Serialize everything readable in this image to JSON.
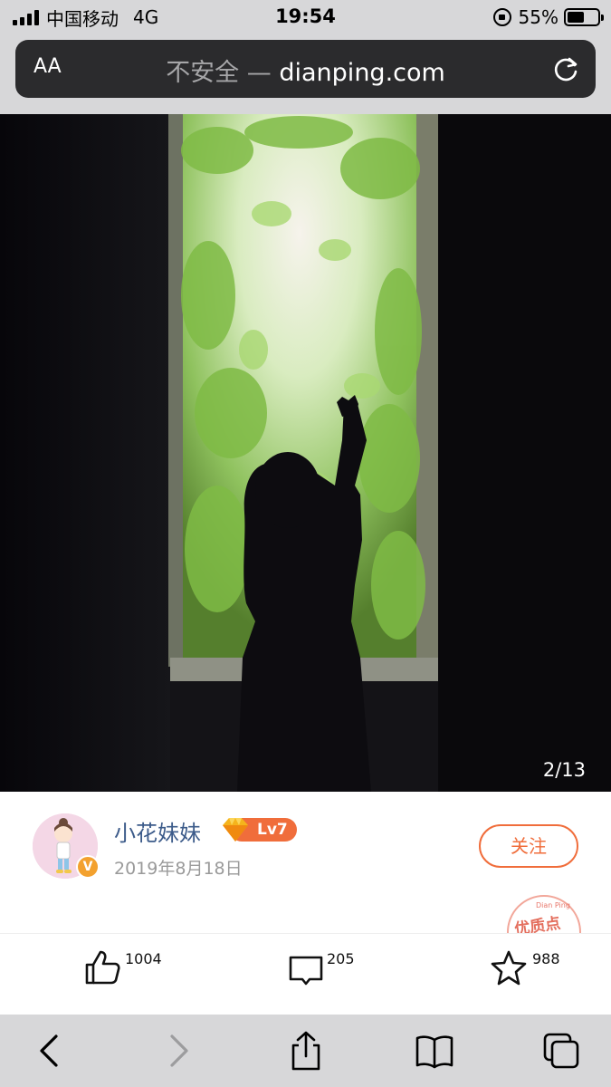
{
  "status_bar": {
    "carrier": "中国移动",
    "network": "4G",
    "time": "19:54",
    "battery_percent": "55%",
    "battery_level": 0.55
  },
  "address_bar": {
    "aa_label": "AA",
    "insecure_label": "不安全 —",
    "domain": "dianping.com"
  },
  "photo": {
    "counter": "2/13"
  },
  "author": {
    "name": "小花妹妹",
    "level": "Lv7",
    "date": "2019年8月18日",
    "follow_label": "关注",
    "verified_mark": "V",
    "stamp_top": "Dian Ping",
    "stamp_text": "优质点"
  },
  "actions": {
    "likes": "1004",
    "comments": "205",
    "favorites": "988"
  },
  "colors": {
    "accent": "#f06d3b",
    "username": "#3c5b8a",
    "chrome": "#d7d7d9"
  }
}
